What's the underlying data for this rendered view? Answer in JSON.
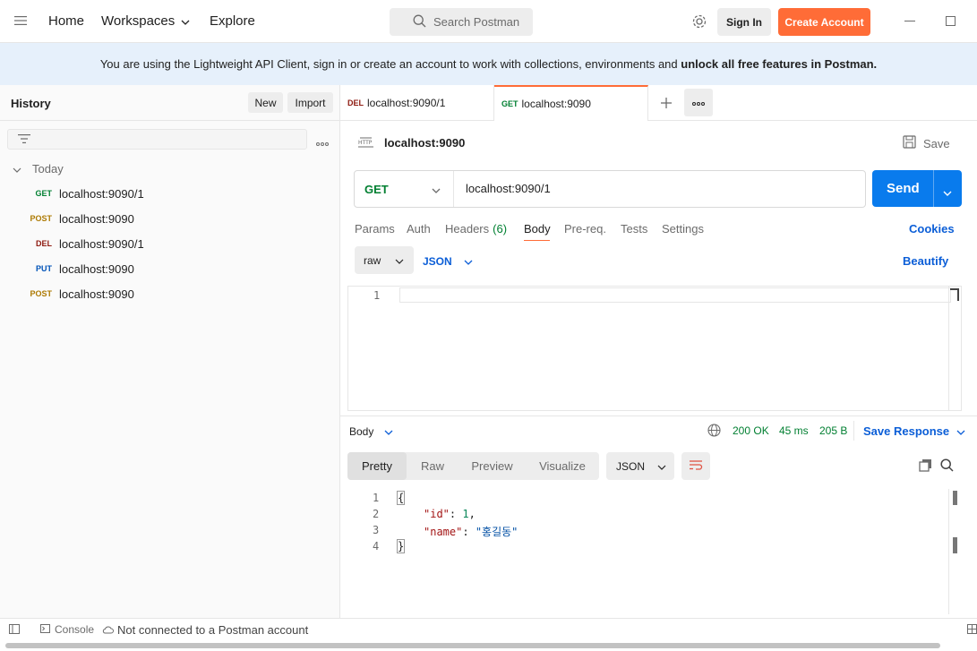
{
  "topbar": {
    "nav": [
      "Home",
      "Workspaces",
      "Explore"
    ],
    "search_placeholder": "Search Postman",
    "sign_in": "Sign In",
    "create_account": "Create Account"
  },
  "banner": {
    "text": "You are using the Lightweight API Client, sign in or create an account to work with collections, environments and ",
    "bold": "unlock all free features in Postman."
  },
  "sidebar": {
    "title": "History",
    "new_label": "New",
    "import_label": "Import",
    "group_label": "Today",
    "items": [
      {
        "method": "GET",
        "url": "localhost:9090/1",
        "color": "#007f31"
      },
      {
        "method": "POST",
        "url": "localhost:9090",
        "color": "#ad7a03"
      },
      {
        "method": "DEL",
        "url": "localhost:9090/1",
        "color": "#8e1a10"
      },
      {
        "method": "PUT",
        "url": "localhost:9090",
        "color": "#0053b8"
      },
      {
        "method": "POST",
        "url": "localhost:9090",
        "color": "#ad7a03"
      }
    ]
  },
  "tabs": [
    {
      "method": "DEL",
      "label": "localhost:9090/1",
      "color": "#8e1a10"
    },
    {
      "method": "GET",
      "label": "localhost:9090",
      "color": "#007f31"
    }
  ],
  "request": {
    "title": "localhost:9090",
    "save_label": "Save",
    "method": "GET",
    "url": "localhost:9090/1",
    "send_label": "Send",
    "subtabs": [
      "Params",
      "Auth",
      "Headers",
      "Body",
      "Pre-req.",
      "Tests",
      "Settings"
    ],
    "headers_count": "(6)",
    "active_subtab": "Body",
    "cookies_label": "Cookies",
    "body_mode": "raw",
    "body_lang": "JSON",
    "beautify_label": "Beautify",
    "editor_line": "1"
  },
  "response": {
    "section_label": "Body",
    "status": "200 OK",
    "time": "45 ms",
    "size": "205 B",
    "save_response": "Save Response",
    "views": [
      "Pretty",
      "Raw",
      "Preview",
      "Visualize"
    ],
    "active_view": "Pretty",
    "format": "JSON",
    "lines": [
      "1",
      "2",
      "3",
      "4"
    ],
    "body": {
      "open": "{",
      "key1": "\"id\"",
      "val1": "1",
      "key2": "\"name\"",
      "val2": "\"홍길동\"",
      "close": "}"
    }
  },
  "statusbar": {
    "console": "Console",
    "connection": "Not connected to a Postman account"
  },
  "colors": {
    "accent": "#ff6c37",
    "send": "#097bed",
    "status_ok": "#007f31",
    "link": "#0b5ed7"
  }
}
